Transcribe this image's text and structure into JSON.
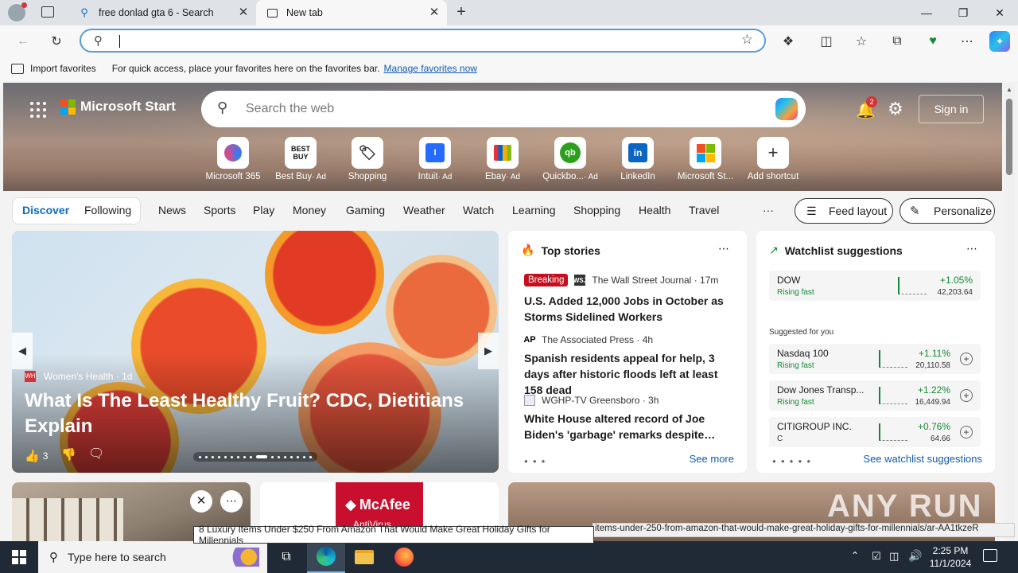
{
  "tabs": [
    {
      "title": "free donlad gta 6 - Search"
    },
    {
      "title": "New tab"
    }
  ],
  "favbar": {
    "import_label": "Import favorites",
    "message": "For quick access, place your favorites here on the favorites bar.",
    "manage_link": "Manage favorites now"
  },
  "header": {
    "brand": "Microsoft Start",
    "search_placeholder": "Search the web",
    "notification_count": "2",
    "signin_label": "Sign in"
  },
  "shortcuts": [
    {
      "label": "Microsoft 365",
      "ad": ""
    },
    {
      "label": "Best Buy",
      "ad": "· Ad"
    },
    {
      "label": "Shopping",
      "ad": ""
    },
    {
      "label": "Intuit",
      "ad": "· Ad"
    },
    {
      "label": "Ebay",
      "ad": "· Ad"
    },
    {
      "label": "Quickbo...",
      "ad": "· Ad"
    },
    {
      "label": "LinkedIn",
      "ad": ""
    },
    {
      "label": "Microsoft St...",
      "ad": ""
    },
    {
      "label": "Add shortcut",
      "ad": ""
    }
  ],
  "nav": {
    "discover": "Discover",
    "following": "Following",
    "items": [
      "News",
      "Sports",
      "Play",
      "Money",
      "Gaming",
      "Weather",
      "Watch",
      "Learning",
      "Shopping",
      "Health",
      "Travel"
    ],
    "more": "···",
    "feed_layout": "Feed layout",
    "personalize": "Personalize"
  },
  "hero_article": {
    "source": "Women's Health",
    "age": "· 1d",
    "title": "What Is The Least Healthy Fruit? CDC, Dietitians Explain",
    "likes": "3"
  },
  "top_stories": {
    "heading": "Top stories",
    "see_more": "See more",
    "items": [
      {
        "badge": "Breaking",
        "source": "The Wall Street Journal",
        "age": "· 17m",
        "title": "U.S. Added 12,000 Jobs in October as Storms Sidelined Workers"
      },
      {
        "badge": "",
        "source": "The Associated Press",
        "age": "· 4h",
        "title": "Spanish residents appeal for help, 3 days after historic floods left at least 158 dead"
      },
      {
        "badge": "",
        "source": "WGHP-TV Greensboro",
        "age": "· 3h",
        "title": "White House altered record of Joe Biden's 'garbage' remarks despite…"
      }
    ]
  },
  "watchlist": {
    "heading": "Watchlist suggestions",
    "suggested_label": "Suggested for you",
    "see_link": "See watchlist suggestions",
    "rows": [
      {
        "name": "DOW",
        "status": "Rising fast",
        "pct": "+1.05%",
        "value": "42,203.64"
      },
      {
        "name": "Nasdaq 100",
        "status": "Rising fast",
        "pct": "+1.11%",
        "value": "20,110.58"
      },
      {
        "name": "Dow Jones Transp...",
        "status": "Rising fast",
        "pct": "+1.22%",
        "value": "16,449.94"
      },
      {
        "name": "CITIGROUP INC.",
        "status": "C",
        "pct": "+0.76%",
        "value": "64.66"
      }
    ]
  },
  "ads": {
    "mcafee": "McAfee",
    "antivirus": "AntiVirus"
  },
  "overlay": {
    "tooltip": "8 Luxury Items Under $250 From Amazon That Would Make Great Holiday Gifts for Millennials",
    "status_url": "items-under-250-from-amazon-that-would-make-great-holiday-gifts-for-millennials/ar-AA1tkzeR"
  },
  "watermark": "ANY RUN",
  "taskbar": {
    "search_placeholder": "Type here to search",
    "time": "2:25 PM",
    "date": "11/1/2024"
  },
  "colors": {
    "accent": "#0f6cbd",
    "rising": "#138a36",
    "breaking": "#c50f1f",
    "taskbar": "#1f2a36"
  }
}
